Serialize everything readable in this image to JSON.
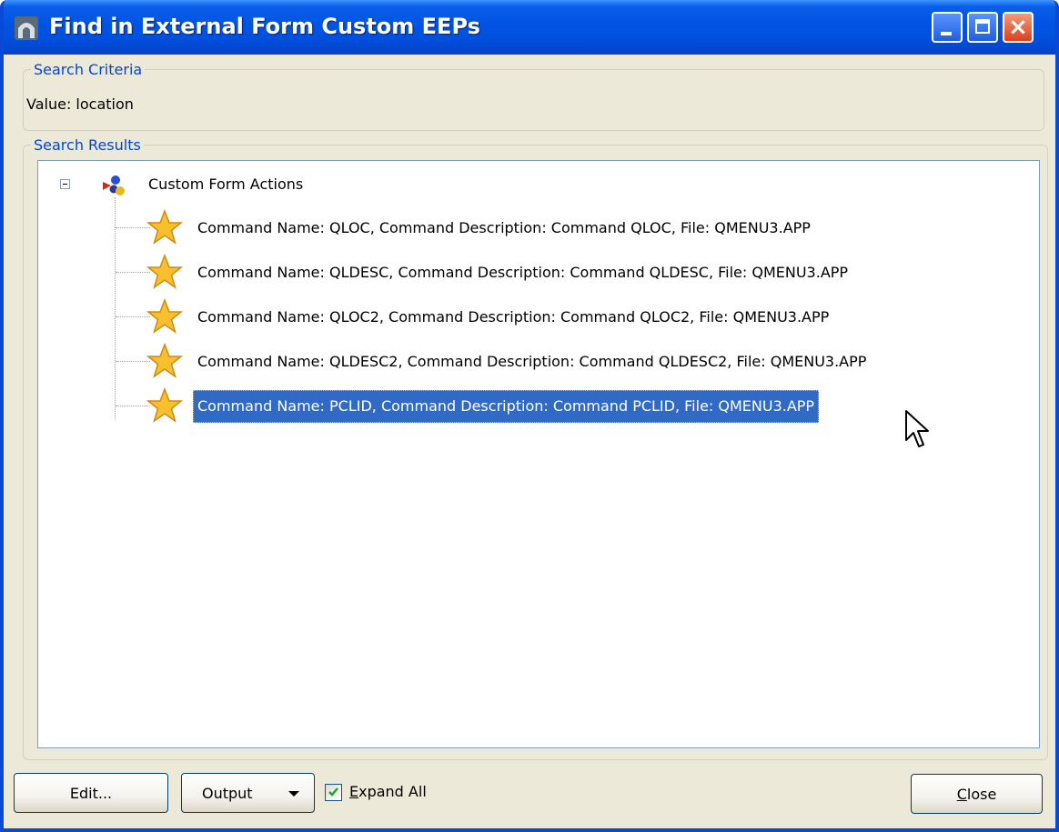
{
  "window": {
    "title": "Find in External Form Custom EEPs",
    "close_glyph": "×"
  },
  "criteria": {
    "legend": "Search Criteria",
    "value_text": "Value: location"
  },
  "results": {
    "legend": "Search Results",
    "root": {
      "label": "Custom Form Actions",
      "icon": "custom-form-actions-icon",
      "expanded": true
    },
    "items": [
      {
        "label": "Command Name: QLOC, Command Description: Command QLOC, File: QMENU3.APP",
        "icon": "star-icon",
        "selected": false
      },
      {
        "label": "Command Name: QLDESC, Command Description: Command QLDESC, File: QMENU3.APP",
        "icon": "star-icon",
        "selected": false
      },
      {
        "label": "Command Name: QLOC2, Command Description: Command QLOC2, File: QMENU3.APP",
        "icon": "star-icon",
        "selected": false
      },
      {
        "label": "Command Name: QLDESC2, Command Description: Command QLDESC2, File: QMENU3.APP",
        "icon": "star-icon",
        "selected": false
      },
      {
        "label": "Command Name: PCLID, Command Description: Command PCLID, File: QMENU3.APP",
        "icon": "star-icon",
        "selected": true
      }
    ]
  },
  "buttons": {
    "edit": "Edit...",
    "output": "Output",
    "expand_all_first": "E",
    "expand_all_rest": "xpand All",
    "expand_all_checked": true,
    "close_first": "C",
    "close_rest": "lose"
  },
  "colors": {
    "title_bar": "#0054e3",
    "selection": "#316ac5",
    "legend_text": "#0046d5",
    "window_face": "#ece9d8"
  }
}
